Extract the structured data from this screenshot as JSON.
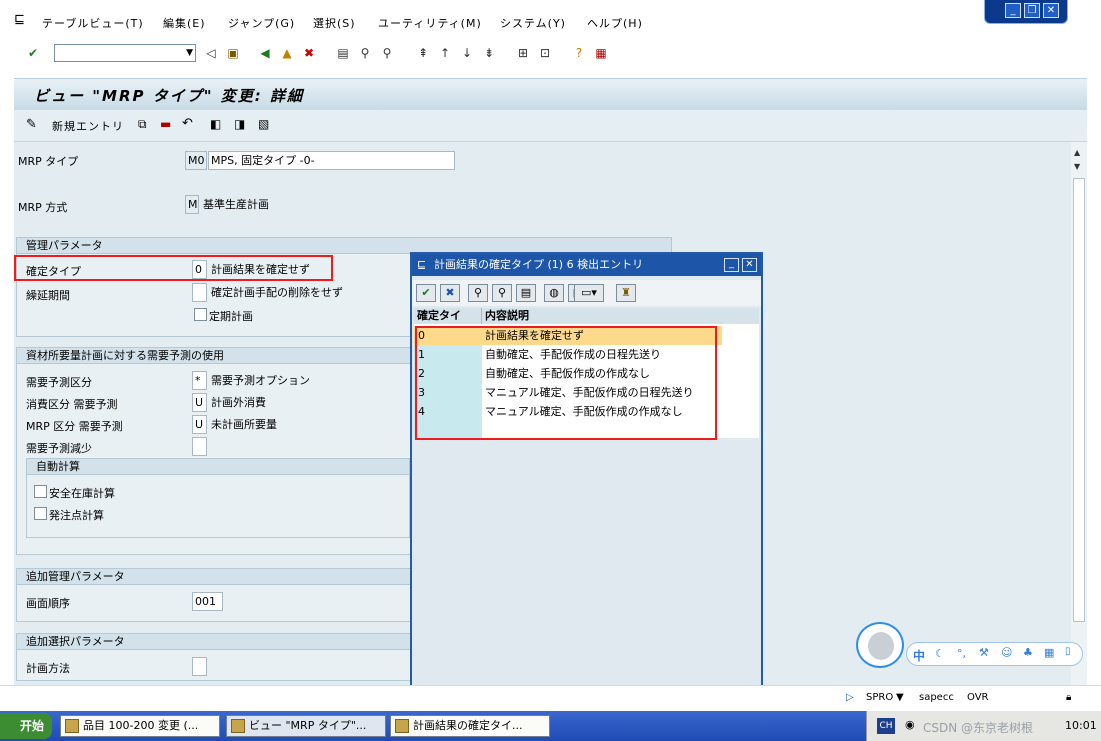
{
  "menu": {
    "items": [
      "テーブルビュー(T)",
      "編集(E)",
      "ジャンプ(G)",
      "選択(S)",
      "ユーティリティ(M)",
      "システム(Y)",
      "ヘルプ(H)"
    ]
  },
  "screen": {
    "title": "ビュー \"MRP タイプ\" 変更: 詳細",
    "new_entry_label": "新規エントリ"
  },
  "header_fields": {
    "mrp_type_label": "MRP タイプ",
    "mrp_type_value": "M0",
    "mrp_type_desc": "MPS, 固定タイプ -0-",
    "mrp_procedure_label": "MRP 方式",
    "mrp_procedure_value": "M",
    "mrp_procedure_desc": "基準生産計画"
  },
  "group_control": {
    "title": "管理パラメータ",
    "firming_type_label": "確定タイプ",
    "firming_type_value": "0",
    "firming_type_desc": "計画結果を確定せず",
    "rollfwd_label": "繰延期間",
    "rollfwd_desc": "確定計画手配の削除をせず",
    "periodic_label": "定期計画"
  },
  "group_forecast": {
    "title": "資材所要量計画に対する需要予測の使用",
    "fc_ind_label": "需要予測区分",
    "fc_ind_value": "*",
    "fc_ind_desc": "需要予測オプション",
    "cons_label": "消費区分 需要予測",
    "cons_value": "U",
    "cons_desc": "計画外消費",
    "mrp_ind_label": "MRP 区分 需要予測",
    "mrp_ind_value": "U",
    "mrp_ind_desc": "未計画所要量",
    "reduce_label": "需要予測減少",
    "auto_title": "自動計算",
    "safety_label": "安全在庫計算",
    "reorder_label": "発注点計算"
  },
  "group_additional": {
    "title": "追加管理パラメータ",
    "screen_seq_label": "画面順序",
    "screen_seq_value": "001"
  },
  "group_selection": {
    "title": "追加選択パラメータ",
    "plan_method_label": "計画方法"
  },
  "popup": {
    "title": "計画結果の確定タイプ (1)    6 検出エントリ",
    "col_key": "確定タイ",
    "col_desc": "内容説明",
    "rows": [
      {
        "key": "0",
        "desc": "計画結果を確定せず"
      },
      {
        "key": "1",
        "desc": "自動確定、手配仮作成の日程先送り"
      },
      {
        "key": "2",
        "desc": "自動確定、手配仮作成の作成なし"
      },
      {
        "key": "3",
        "desc": "マニュアル確定、手配仮作成の日程先送り"
      },
      {
        "key": "4",
        "desc": "マニュアル確定、手配仮作成の作成なし"
      }
    ]
  },
  "status": {
    "system": "SPRO",
    "client": "sapecc",
    "mode": "OVR"
  },
  "taskbar": {
    "start": "开始",
    "tasks": [
      "品目 100-200 変更 (...",
      "ビュー \"MRP タイプ\"...",
      "計画結果の確定タイ..."
    ],
    "ime": "CH",
    "clock": "10:01",
    "watermark": "CSDN @东京老树根"
  },
  "chat": {
    "lang": "中"
  },
  "colors": {
    "accent": "#1d56a8",
    "highlight_border": "#ee1c1c",
    "selected_row": "#fdd98b"
  }
}
